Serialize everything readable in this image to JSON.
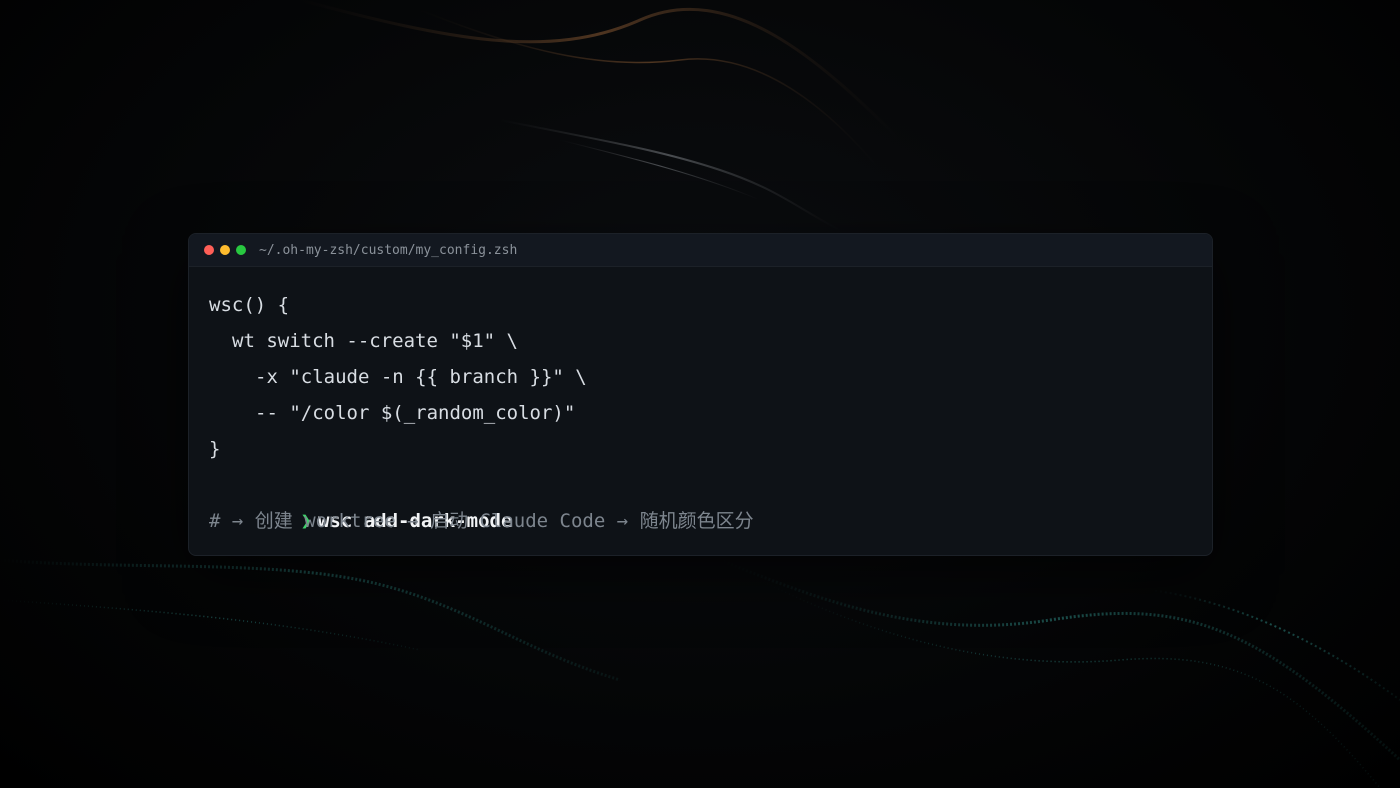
{
  "window": {
    "title": "~/.oh-my-zsh/custom/my_config.zsh"
  },
  "code": {
    "lines": [
      "wsc() {",
      "wt switch --create \"$1\" \\",
      "-x \"claude -n {{ branch }}\" \\",
      "-- \"/color $(_random_color)\"",
      "}"
    ],
    "prompt_symbol": "❯",
    "command": "wsc add-dark-mode",
    "comment": "# → 创建 worktree → 启动 Claude Code → 随机颜色区分"
  },
  "colors": {
    "background": "#000000",
    "terminal_bg": "#0e1217",
    "prompt_green": "#3fd16b",
    "close_red": "#ff5f57",
    "minimize_yellow": "#febc2e",
    "maximize_green": "#28c840"
  }
}
